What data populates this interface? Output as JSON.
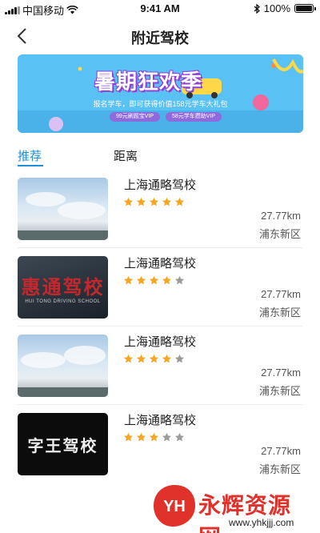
{
  "status_bar": {
    "carrier": "中国移动",
    "time": "9:41 AM",
    "battery": "100%"
  },
  "nav": {
    "title": "附近驾校"
  },
  "banner": {
    "headline": "暑期狂欢季",
    "subline": "报名学车，即可获得价值158元学车大礼包",
    "pill_1": "99元刷题宝VIP",
    "pill_2": "58元学车攒助VIP"
  },
  "tabs": [
    {
      "label": "推荐",
      "active": true
    },
    {
      "label": "距离",
      "active": false
    }
  ],
  "schools": [
    {
      "name": "上海通略驾校",
      "rating": 5,
      "distance": "27.77km",
      "district": "浦东新区",
      "thumb": "sky"
    },
    {
      "name": "上海通略驾校",
      "rating": 4,
      "distance": "27.77km",
      "district": "浦东新区",
      "thumb": "huitong-logo",
      "logo_text": "惠通驾校",
      "logo_sub": "HUI TONG DRIVING SCHOOL"
    },
    {
      "name": "上海通略驾校",
      "rating": 4,
      "distance": "27.77km",
      "district": "浦东新区",
      "thumb": "sky"
    },
    {
      "name": "上海通略驾校",
      "rating": 3,
      "distance": "27.77km",
      "district": "浦东新区",
      "thumb": "black-logo",
      "logo_text": "字王驾校"
    }
  ],
  "watermark": {
    "text": "永辉资源网",
    "url": "www.yhkjjj.com",
    "badge": "YH"
  },
  "colors": {
    "accent": "#1e8fd6",
    "star_on": "#f5a623",
    "star_off": "#9b9b9b",
    "watermark": "#e0312a"
  }
}
